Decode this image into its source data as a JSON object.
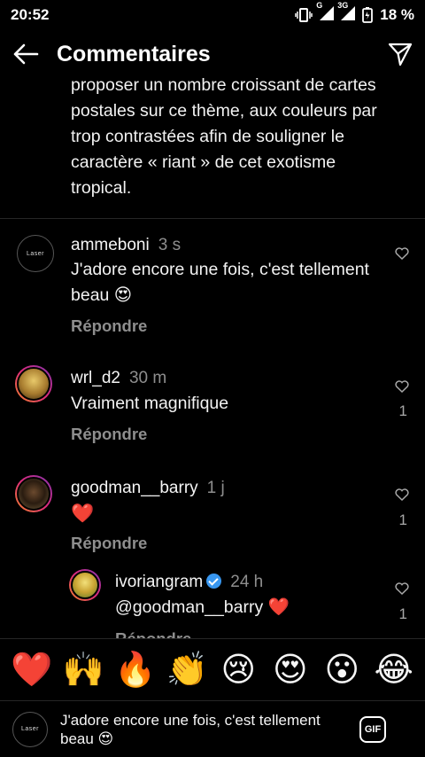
{
  "status_bar": {
    "time": "20:52",
    "network": "G",
    "network2": "3G",
    "battery": "18 %"
  },
  "header": {
    "title": "Commentaires",
    "back_icon": "arrow-left-icon",
    "send_icon": "paper-plane-icon"
  },
  "caption": {
    "text": "proposer un nombre croissant de cartes postales sur ce thème, aux couleurs par trop contrastées afin de souligner le caractère « riant » de cet exotisme tropical."
  },
  "comments": [
    {
      "username": "ammeboni",
      "time": "3 s",
      "text": "J'adore encore une fois, c'est tellement beau 😍",
      "reply": "Répondre",
      "likes": ""
    },
    {
      "username": "wrl_d2",
      "time": "30 m",
      "text": "Vraiment magnifique",
      "reply": "Répondre",
      "likes": "1"
    },
    {
      "username": "goodman__barry",
      "time": "1 j",
      "text": "❤️",
      "reply": "Répondre",
      "likes": "1"
    },
    {
      "username": "ivoriangram",
      "time": "24 h",
      "text": "@goodman__barry ❤️",
      "reply": "Répondre",
      "likes": "1",
      "verified": true
    }
  ],
  "emoji_bar": [
    "❤️",
    "🙌",
    "🔥",
    "👏",
    "😢",
    "😍",
    "😮",
    "😂"
  ],
  "composer": {
    "text": "J'adore encore une fois, c'est tellement beau 😍",
    "gif_label": "GIF"
  },
  "colors": {
    "background": "#000000",
    "secondary_text": "#8e8e8e",
    "verified": "#3897f0"
  }
}
